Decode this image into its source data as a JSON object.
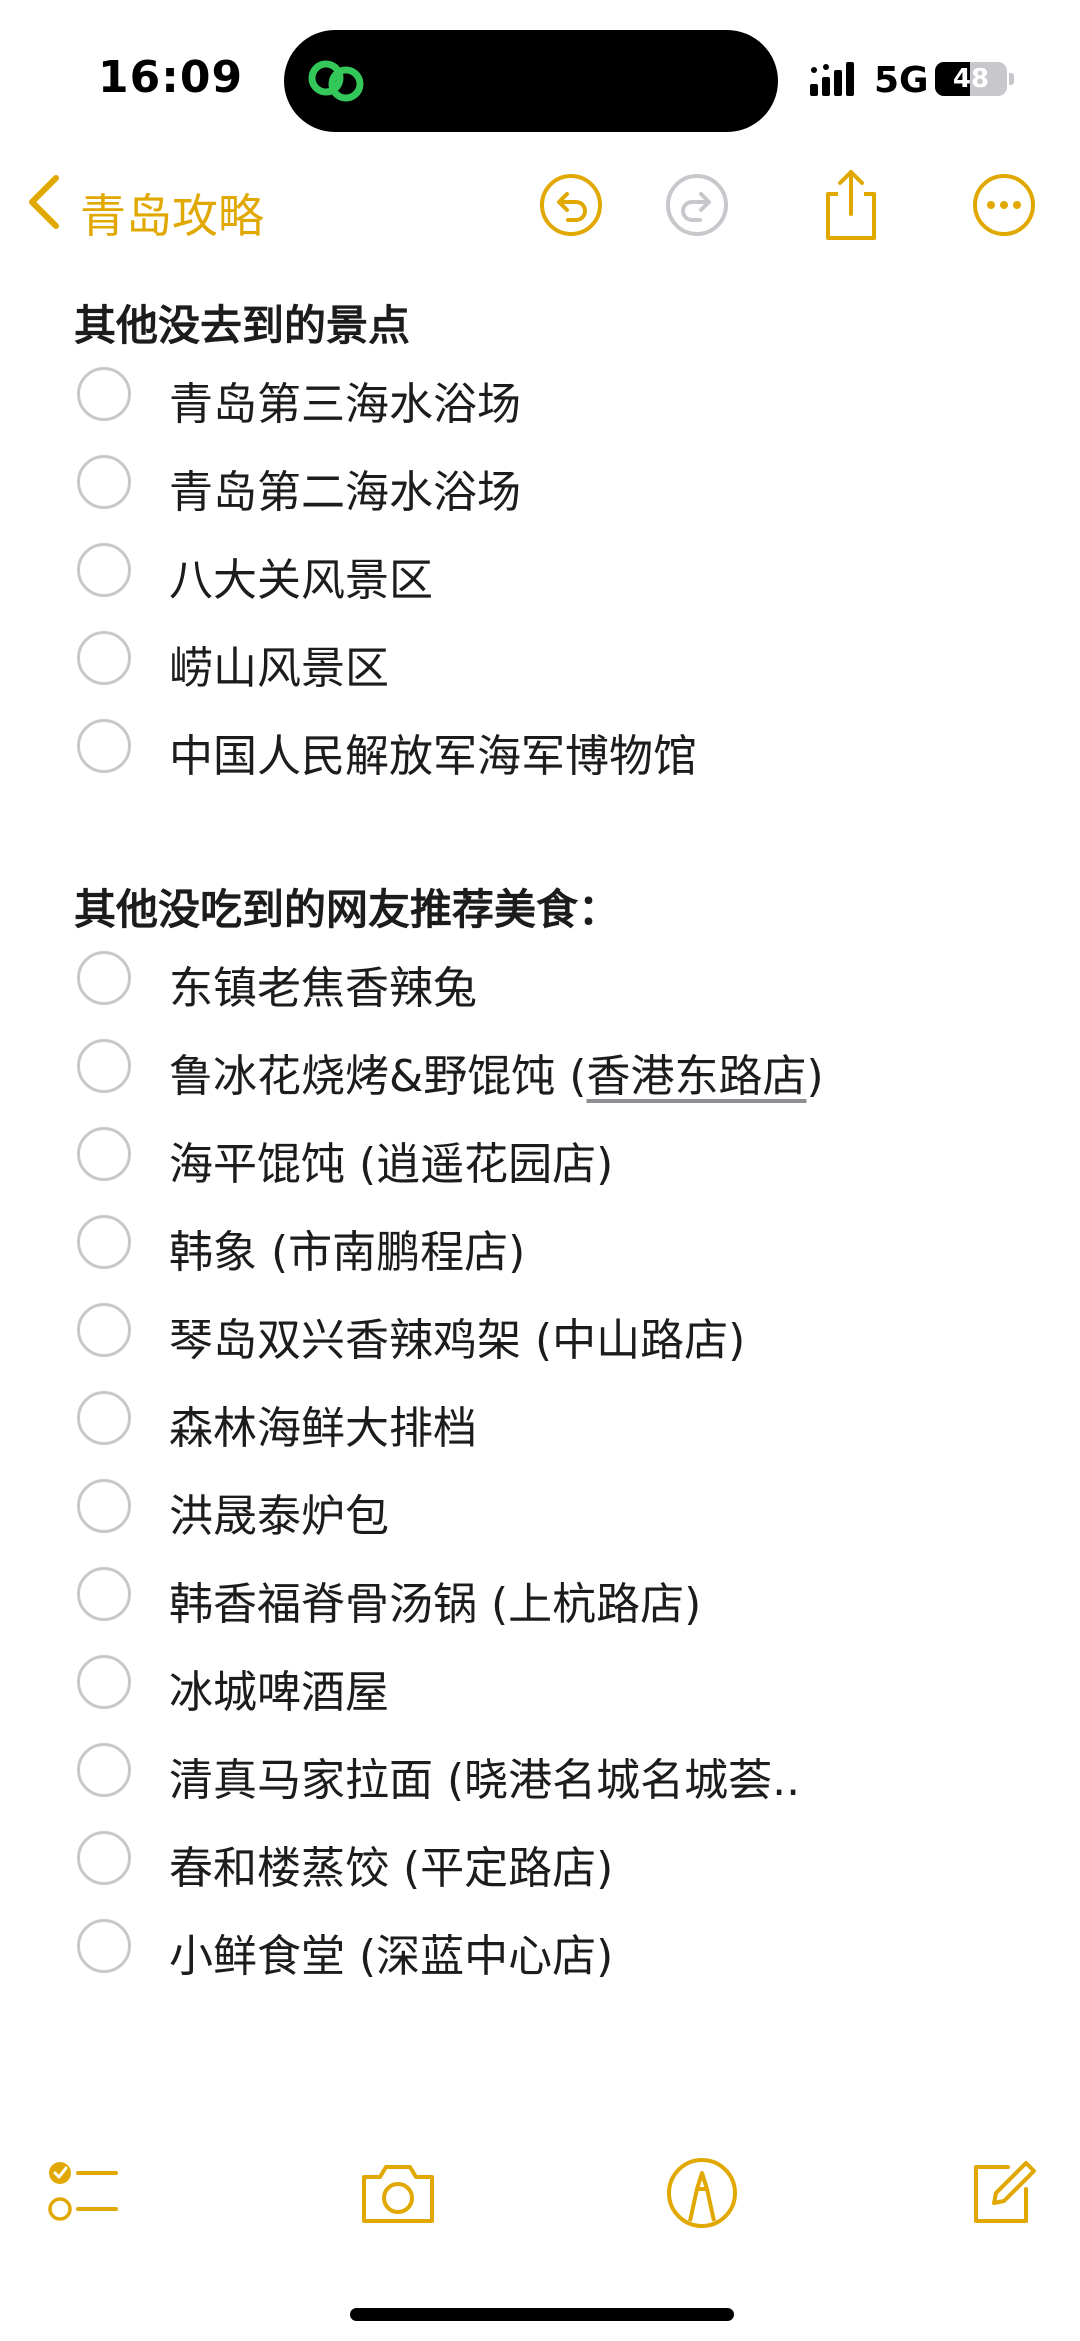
{
  "status_bar": {
    "time": "16:09",
    "network": "5G",
    "battery": "48",
    "battery_level": 0.48
  },
  "nav": {
    "back_label": "青岛攻略"
  },
  "sections": {
    "sights_heading": "其他没去到的景点",
    "sights": [
      "青岛第三海水浴场",
      "青岛第二海水浴场",
      "八大关风景区",
      "崂山风景区",
      "中国人民解放军海军博物馆"
    ],
    "food_heading": "其他没吃到的网友推荐美食：",
    "food": [
      {
        "name": "东镇老焦香辣兔"
      },
      {
        "name": "鲁冰花烧烤&野馄饨 (",
        "link": "香港东路店",
        "suffix": ")"
      },
      {
        "name": "海平馄饨 (逍遥花园店)"
      },
      {
        "name": "韩象 (市南鹏程店)"
      },
      {
        "name": "琴岛双兴香辣鸡架 (中山路店)"
      },
      {
        "name": "森林海鲜大排档"
      },
      {
        "name": "洪晟泰炉包"
      },
      {
        "name": "韩香福脊骨汤锅 (上杭路店)"
      },
      {
        "name": "冰城啤酒屋"
      },
      {
        "name": "清真马家拉面 (晓港名城名城荟.."
      },
      {
        "name": "春和楼蒸饺 (平定路店)"
      },
      {
        "name": "小鲜食堂 (深蓝中心店)"
      }
    ]
  },
  "colors": {
    "accent": "#e0a800",
    "checkbox_border": "#c7c7cc",
    "text": "#1c1c1e"
  },
  "icons": {
    "back": "chevron-left-icon",
    "undo": "undo-icon",
    "redo": "redo-icon",
    "share": "share-icon",
    "more": "ellipsis-circle-icon",
    "checklist": "checklist-icon",
    "camera": "camera-icon",
    "markup": "markup-pen-icon",
    "compose": "compose-icon"
  }
}
